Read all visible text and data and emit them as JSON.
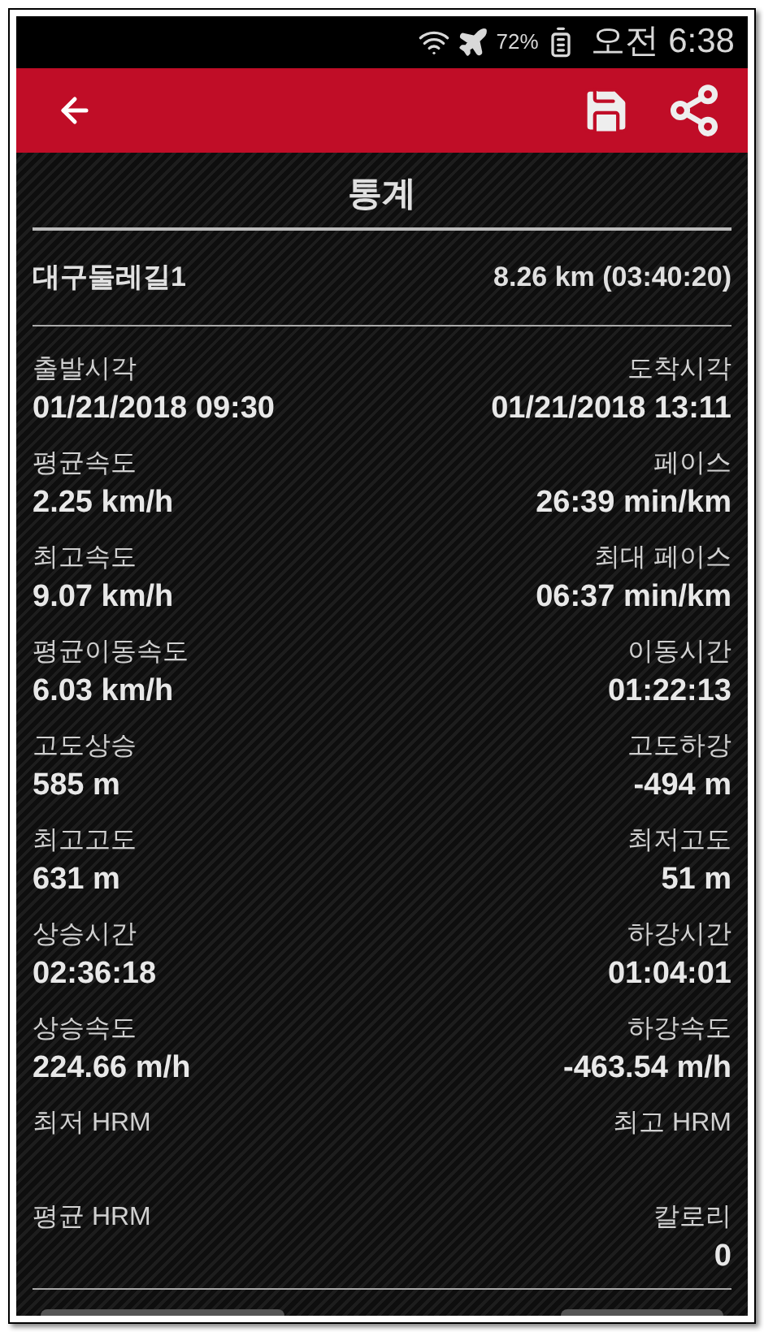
{
  "status_bar": {
    "battery": "72%",
    "time": "오전 6:38"
  },
  "title": "통계",
  "route": {
    "name": "대구둘레길1",
    "summary": "8.26 km (03:40:20)"
  },
  "stats": [
    {
      "left": {
        "label": "출발시각",
        "value": "01/21/2018 09:30"
      },
      "right": {
        "label": "도착시각",
        "value": "01/21/2018 13:11"
      }
    },
    {
      "left": {
        "label": "평균속도",
        "value": "2.25 km/h"
      },
      "right": {
        "label": "페이스",
        "value": "26:39 min/km"
      }
    },
    {
      "left": {
        "label": "최고속도",
        "value": "9.07 km/h"
      },
      "right": {
        "label": "최대 페이스",
        "value": "06:37 min/km"
      }
    },
    {
      "left": {
        "label": "평균이동속도",
        "value": "6.03 km/h"
      },
      "right": {
        "label": "이동시간",
        "value": "01:22:13"
      }
    },
    {
      "left": {
        "label": "고도상승",
        "value": "585 m"
      },
      "right": {
        "label": "고도하강",
        "value": "-494 m"
      }
    },
    {
      "left": {
        "label": "최고고도",
        "value": "631 m"
      },
      "right": {
        "label": "최저고도",
        "value": "51 m"
      }
    },
    {
      "left": {
        "label": "상승시간",
        "value": "02:36:18"
      },
      "right": {
        "label": "하강시간",
        "value": "01:04:01"
      }
    },
    {
      "left": {
        "label": "상승속도",
        "value": "224.66 m/h"
      },
      "right": {
        "label": "하강속도",
        "value": "-463.54 m/h"
      }
    },
    {
      "left": {
        "label": "최저 HRM"
      },
      "right": {
        "label": "최고 HRM"
      }
    },
    {
      "left": {
        "label": "평균 HRM"
      },
      "right": {
        "label": "칼로리",
        "value": "0"
      }
    }
  ]
}
